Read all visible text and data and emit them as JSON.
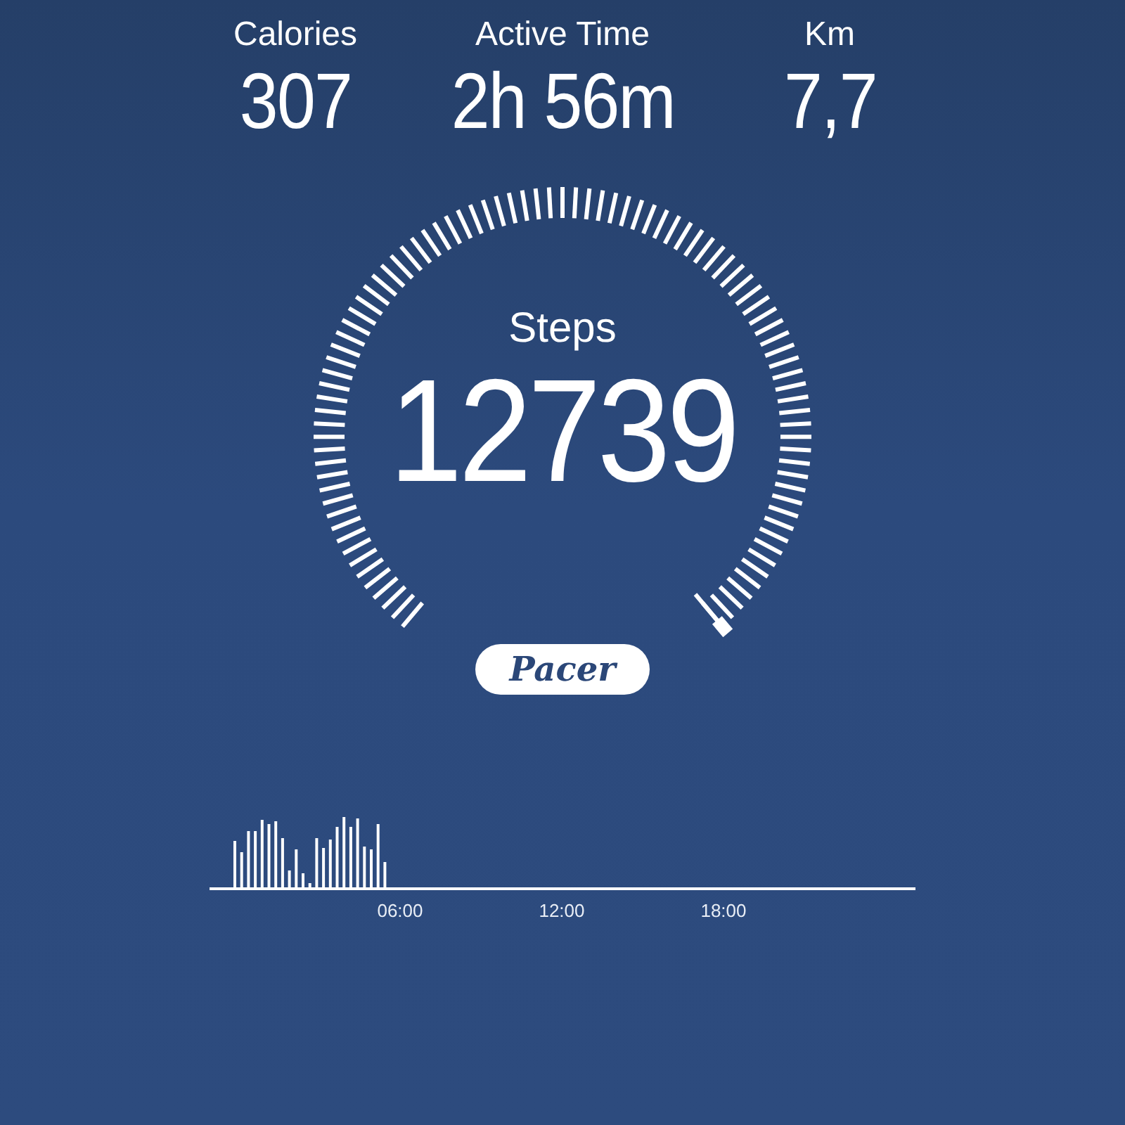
{
  "stats": [
    {
      "label": "Calories",
      "value": "307"
    },
    {
      "label": "Active Time",
      "value": "2h 56m"
    },
    {
      "label": "Km",
      "value": "7,7"
    }
  ],
  "gauge": {
    "label": "Steps",
    "value": "12739"
  },
  "logo": {
    "text": "Pacer"
  },
  "activity_chart": {
    "x_labels": [
      "06:00",
      "12:00",
      "18:00"
    ]
  }
}
